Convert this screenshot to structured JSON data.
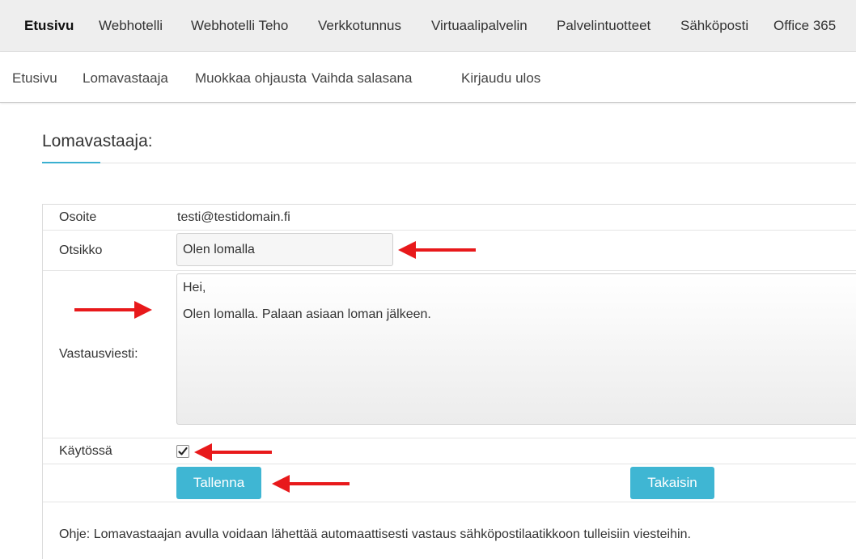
{
  "top_nav": {
    "items": [
      "Etusivu",
      "Webhotelli",
      "Webhotelli Teho",
      "Verkkotunnus",
      "Virtuaalipalvelin",
      "Palvelintuotteet",
      "Sähköposti",
      "Office 365"
    ],
    "active": "Etusivu"
  },
  "sub_nav": {
    "items": [
      "Etusivu",
      "Lomavastaaja",
      "Muokkaa ohjausta",
      "Vaihda salasana",
      "Kirjaudu ulos"
    ]
  },
  "page": {
    "title": "Lomavastaaja:"
  },
  "form": {
    "address_label": "Osoite",
    "address_value": "testi@testidomain.fi",
    "subject_label": "Otsikko",
    "subject_value": "Olen lomalla",
    "message_label": "Vastausviesti:",
    "message_lines": [
      "Hei,",
      "Olen lomalla. Palaan asiaan loman jälkeen."
    ],
    "enabled_label": "Käytössä",
    "enabled_checked": true,
    "save_label": "Tallenna",
    "back_label": "Takaisin"
  },
  "help_text": "Ohje: Lomavastaajan avulla voidaan lähettää automaattisesti vastaus sähköpostilaatikkoon tulleisiin viesteihin.",
  "colors": {
    "accent": "#3fb6d3",
    "arrow": "#e8191b",
    "topnav_bg": "#eeeeee"
  }
}
